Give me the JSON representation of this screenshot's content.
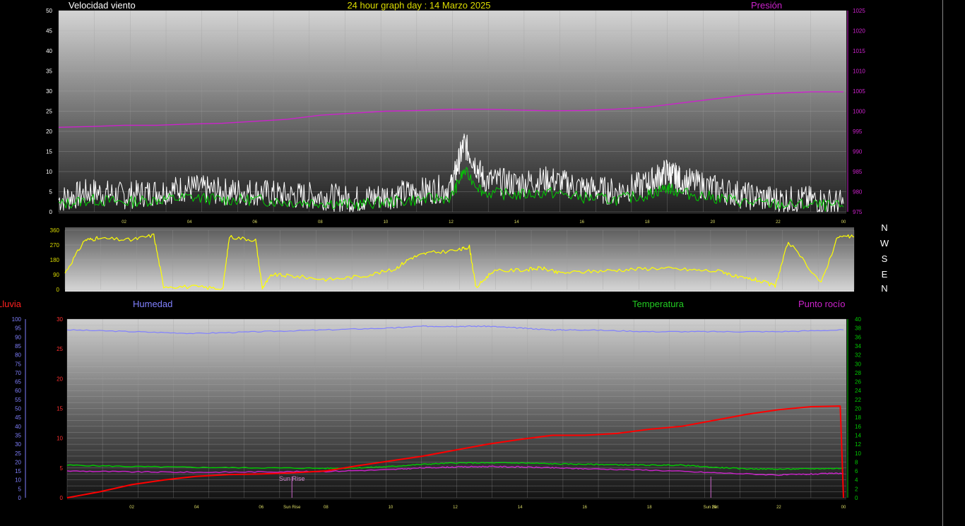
{
  "header": {
    "wind_label": "Velocidad viento",
    "graph_title": "24 hour graph day : 14 Marzo 2025",
    "pressure_label": "Presión"
  },
  "lower_header": {
    "rain_label": "Lluvia",
    "humidity_label": "Humedad",
    "temperature_label": "Temperatura",
    "dewpoint_label": "Punto rocío"
  },
  "compass": [
    "N",
    "W",
    "S",
    "E",
    "N"
  ],
  "sun": {
    "rise_label": "Sun Rise",
    "set_label": "Sun Set",
    "rise_hour": 6.95,
    "set_hour": 19.9
  },
  "colors": {
    "wind": "#ffffff",
    "wind_avg": "#00cc00",
    "pressure": "#cc22cc",
    "direction": "#ffff00",
    "rain": "#ff0000",
    "humidity": "#8080ff",
    "temperature": "#00cc00",
    "dewpoint": "#cc22cc",
    "x_tick": "#dddd66"
  },
  "chart_data": [
    {
      "type": "line",
      "title": "24 hour graph day : 14 Marzo 2025",
      "x_ticks": [
        "02",
        "04",
        "06",
        "08",
        "10",
        "12",
        "14",
        "16",
        "18",
        "20",
        "22",
        "00"
      ],
      "y_left": {
        "label": "Velocidad viento",
        "ticks": [
          0,
          5,
          10,
          15,
          20,
          25,
          30,
          35,
          40,
          45,
          50
        ],
        "range": [
          0,
          50
        ]
      },
      "y_right": {
        "label": "Presión",
        "ticks": [
          975,
          980,
          985,
          990,
          995,
          1000,
          1005,
          1010,
          1015,
          1020,
          1025
        ],
        "range": [
          975,
          1025
        ]
      },
      "series": [
        {
          "name": "Velocidad viento",
          "axis": "left",
          "x": [
            0,
            1,
            2,
            3,
            4,
            5,
            6,
            7,
            8,
            9,
            10,
            11,
            12,
            12.4,
            13,
            14,
            15,
            16,
            17,
            18,
            18.6,
            19,
            20,
            21,
            22,
            23,
            24
          ],
          "y": [
            3,
            5,
            4,
            5,
            6,
            5,
            5,
            4,
            4,
            3,
            4,
            5,
            6,
            17,
            8,
            7,
            8,
            6,
            5,
            7,
            10,
            8,
            6,
            4,
            3,
            3,
            2
          ]
        },
        {
          "name": "Presión",
          "axis": "right",
          "x": [
            0,
            1,
            2,
            3,
            4,
            5,
            6,
            7,
            8,
            9,
            10,
            11,
            12,
            13,
            14,
            15,
            16,
            17,
            18,
            19,
            20,
            21,
            22,
            23,
            24
          ],
          "y": [
            996,
            996.2,
            996.5,
            996.5,
            996.8,
            997,
            997.5,
            998,
            999,
            999.5,
            1000,
            1000.2,
            1000.5,
            1000.5,
            1000.3,
            1000.1,
            1000.2,
            1000.5,
            1001,
            1002,
            1003,
            1004,
            1004.5,
            1004.8,
            1004.8
          ]
        }
      ]
    },
    {
      "type": "line",
      "title": "",
      "y_left": {
        "ticks": [
          0,
          90,
          180,
          270,
          360
        ],
        "range": [
          0,
          360
        ]
      },
      "series": [
        {
          "name": "",
          "axis": "left",
          "x": [
            0,
            0.6,
            1,
            2,
            2.7,
            3,
            4,
            4.8,
            5,
            5.8,
            6,
            6.3,
            7,
            8,
            9,
            10,
            10.5,
            11,
            12,
            12.3,
            12.5,
            13,
            14,
            14.5,
            15,
            16,
            17,
            18,
            19,
            20,
            20.5,
            21,
            21.6,
            22,
            23,
            23.5,
            24
          ],
          "y": [
            100,
            300,
            310,
            300,
            330,
            20,
            15,
            5,
            320,
            300,
            10,
            90,
            80,
            60,
            80,
            120,
            190,
            220,
            240,
            260,
            10,
            110,
            120,
            130,
            100,
            110,
            120,
            130,
            120,
            110,
            70,
            60,
            20,
            290,
            40,
            320,
            320
          ]
        }
      ]
    },
    {
      "type": "line",
      "title": "",
      "y_far_left": {
        "label": "Humedad",
        "ticks": [
          0,
          5,
          10,
          15,
          20,
          25,
          30,
          35,
          40,
          45,
          50,
          55,
          60,
          65,
          70,
          75,
          80,
          85,
          90,
          95,
          100
        ],
        "range": [
          0,
          100
        ]
      },
      "y_left": {
        "label": "Lluvia",
        "ticks": [
          0,
          5,
          10,
          15,
          20,
          25,
          30
        ],
        "range": [
          0,
          30
        ]
      },
      "y_right": {
        "label": "Temperatura",
        "ticks": [
          0,
          2,
          4,
          6,
          8,
          10,
          12,
          14,
          16,
          18,
          20,
          22,
          24,
          26,
          28,
          30,
          32,
          34,
          36,
          38,
          40
        ],
        "range": [
          0,
          40
        ]
      },
      "series": [
        {
          "name": "Lluvia",
          "axis": "left",
          "x": [
            0,
            0.5,
            1,
            1.5,
            2,
            3,
            4,
            5,
            6,
            7,
            8,
            9,
            10,
            11,
            12,
            13,
            14,
            15,
            16,
            17,
            18,
            19,
            20,
            21,
            22,
            23,
            23.9,
            24
          ],
          "y": [
            0,
            0.5,
            1,
            1.6,
            2.2,
            3,
            3.6,
            3.9,
            4,
            4.2,
            4.5,
            5.4,
            6.2,
            7,
            8,
            9,
            9.8,
            10.5,
            10.5,
            10.8,
            11.5,
            12,
            13,
            14,
            14.8,
            15.3,
            15.4,
            0
          ]
        },
        {
          "name": "Humedad",
          "axis": "far_left",
          "x": [
            0,
            2,
            4,
            6,
            8,
            10,
            11,
            12,
            13,
            14,
            15,
            16,
            18,
            20,
            22,
            24
          ],
          "y": [
            94,
            93,
            92,
            93,
            94,
            95,
            96,
            96,
            96,
            95,
            94,
            94,
            93,
            93,
            93,
            94
          ]
        },
        {
          "name": "Temperatura",
          "axis": "right",
          "x": [
            0,
            2,
            4,
            6,
            8,
            9,
            10,
            11,
            12,
            13,
            14,
            15,
            16,
            17,
            18,
            19,
            20,
            21,
            22,
            23,
            24
          ],
          "y": [
            7.3,
            7,
            6.8,
            6.7,
            6.6,
            6.7,
            7,
            7.5,
            7.8,
            7.8,
            7.8,
            7.6,
            7.5,
            7.4,
            7.3,
            7.3,
            6.8,
            6.5,
            6.4,
            6.5,
            6.6
          ]
        },
        {
          "name": "Punto rocío",
          "axis": "right",
          "x": [
            0,
            2,
            4,
            6,
            8,
            10,
            11,
            12,
            13,
            14,
            15,
            16,
            18,
            20,
            22,
            23,
            24
          ],
          "y": [
            6,
            5.8,
            5.7,
            5.8,
            5.9,
            6.3,
            6.7,
            6.9,
            7,
            6.9,
            6.7,
            6.5,
            6.2,
            5.6,
            5.1,
            5.3,
            5.5
          ]
        }
      ]
    }
  ]
}
